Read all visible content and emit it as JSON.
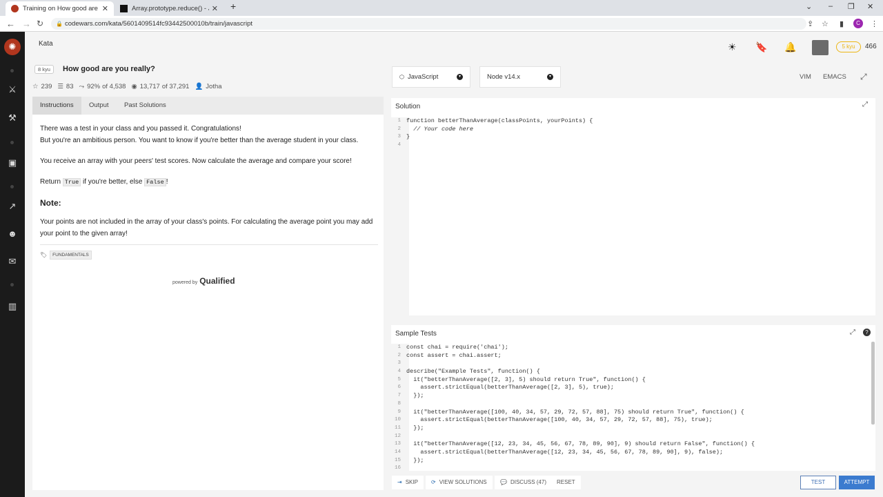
{
  "browser": {
    "tabs": [
      {
        "title": "Training on How good are you really? | Codewars",
        "active": true
      },
      {
        "title": "Array.prototype.reduce() - JavaScript | MDN",
        "active": false
      }
    ],
    "url": "codewars.com/kata/5601409514fc93442500010b/train/javascript",
    "profile_initial": "C"
  },
  "header": {
    "kata_link": "Kata",
    "rank_badge": "5 kyu",
    "honor": "466"
  },
  "kata": {
    "kyu": "8 kyu",
    "title": "How good are you really?",
    "stats": {
      "stars": "239",
      "collections": "83",
      "satisfaction": "92%",
      "satisfaction_of": "of 4,538",
      "completed": "13,717",
      "completed_of": "of 37,291",
      "author": "Jotha"
    },
    "tabs": [
      "Instructions",
      "Output",
      "Past Solutions"
    ],
    "description": {
      "line1": "There was a test in your class and you passed it. Congratulations!",
      "line2": "But you're an ambitious person. You want to know if you're better than the average student in your class.",
      "line3": "You receive an array with your peers' test scores. Now calculate the average and compare your score!",
      "return_pre": "Return ",
      "true_code": "True",
      "return_mid": " if you're better, else ",
      "false_code": "False",
      "return_post": "!",
      "note_heading": "Note:",
      "note_text": "Your points are not included in the array of your class's points. For calculating the average point you may add your point to the given array!"
    },
    "tag": "FUNDAMENTALS",
    "powered_by": "powered by",
    "powered_brand": "Qualified"
  },
  "editor": {
    "language": "JavaScript",
    "runtime": "Node v14.x",
    "vim": "VIM",
    "emacs": "EMACS",
    "solution_title": "Solution",
    "solution_lines": [
      "function betterThanAverage(classPoints, yourPoints) {",
      "  // Your code here",
      "}",
      ""
    ],
    "tests_title": "Sample Tests",
    "test_lines": [
      "const chai = require('chai');",
      "const assert = chai.assert;",
      "",
      "describe(\"Example Tests\", function() {",
      "  it(\"betterThanAverage([2, 3], 5) should return True\", function() {",
      "    assert.strictEqual(betterThanAverage([2, 3], 5), true);",
      "  });",
      "",
      "  it(\"betterThanAverage([100, 40, 34, 57, 29, 72, 57, 88], 75) should return True\", function() {",
      "    assert.strictEqual(betterThanAverage([100, 40, 34, 57, 29, 72, 57, 88], 75), true);",
      "  });",
      "",
      "  it(\"betterThanAverage([12, 23, 34, 45, 56, 67, 78, 89, 90], 9) should return False\", function() {",
      "    assert.strictEqual(betterThanAverage([12, 23, 34, 45, 56, 67, 78, 89, 90], 9), false);",
      "  });",
      ""
    ]
  },
  "actions": {
    "skip": "SKIP",
    "view_solutions": "VIEW SOLUTIONS",
    "discuss": "DISCUSS (47)",
    "reset": "RESET",
    "test": "TEST",
    "attempt": "ATTEMPT"
  }
}
